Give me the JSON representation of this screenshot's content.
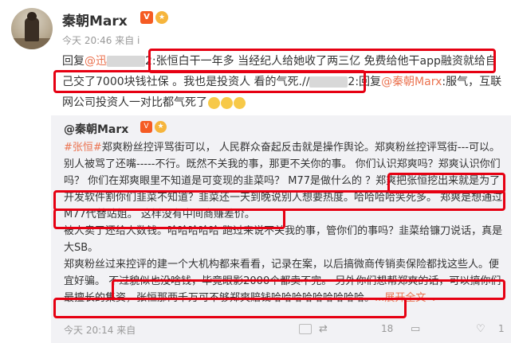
{
  "post": {
    "username": "秦朝Marx",
    "vip_badge": "V",
    "fan_badge": "★",
    "meta_time": "今天 20:46 来自 i",
    "reply_prefix": "回复",
    "reply_mention": "@迅",
    "reply_blur_tail": "2",
    "reply_part1": ":张恒白干一年多 当经纪人给她收了两三亿 免费给他干app融资就给自己交了7000块钱社保 。我也是投资人 看的气死.//",
    "reply_blur_tail2": "2",
    "reply_part2": ":回复",
    "reply_mention2": "@秦朝Marx",
    "reply_part3": ":服气，互联网公司投资人一对比都气死了"
  },
  "quote": {
    "username": "@秦朝Marx",
    "vip_badge": "V",
    "fan_badge": "★",
    "tag": "#张恒#",
    "p1": "郑爽粉丝控评骂街可以， 人民群众奋起反击就是操作舆论。郑爽粉丝控评骂街---可以。 别人被骂了还嘴-----不行。既然不关我的事，那更不关你的事。 你们认识郑爽吗？郑爽认识你们吗？ 你们在郑爽眼里不知道是可变现的韭菜吗？ M77是做什么的 ？郑爽把张恒挖出来就是为了开发软件割你们韭菜不知道？韭菜还一天到晚说别人想要热度。哈哈哈哈笑死多。 郑爽是想通过M77代替站姐。 这样没有中间商赚差价。",
    "p2": "被人卖了还给人数钱。哈哈哈哈哈 跑过来说不关我的事，管你们的事吗？韭菜给镰刀说话，真是大SB。",
    "p3": "郑爽粉丝过来控评的建一个大机构都来看看，记录在案，以后搞微商传销卖保险都找这些人。便宜好骗。 不过貌似也没啥钱，毕竟眼影2000个都卖不完。 另外你们想帮郑爽的话，可以搞你们最擅长的集资，张恒那两千万可不够郑爽赔钱哈哈哈哈哈哈哈哈哈。",
    "expand": "...展开全文",
    "expand_arrow": "⌄",
    "footer_source": "今天 20:14 来自",
    "repost_count": "18",
    "comment_count": "",
    "like_count": "1"
  }
}
